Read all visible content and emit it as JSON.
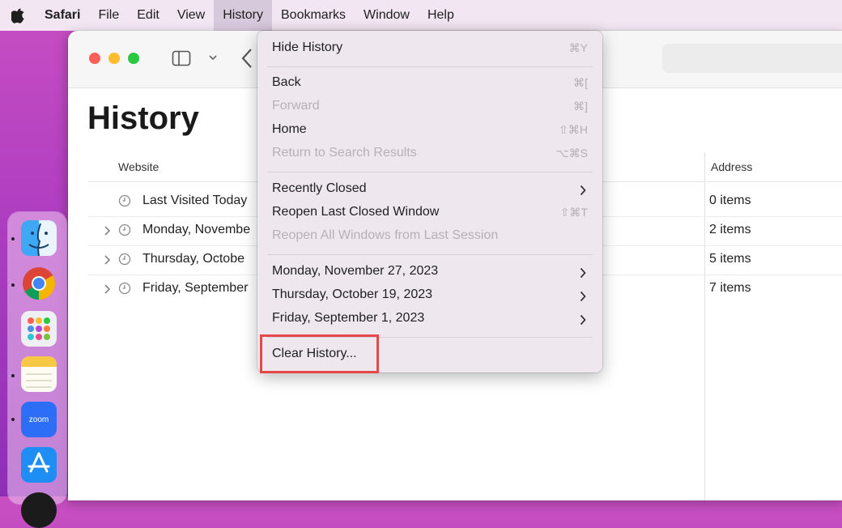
{
  "menubar": {
    "app_name": "Safari",
    "items": [
      "File",
      "Edit",
      "View",
      "History",
      "Bookmarks",
      "Window",
      "Help"
    ],
    "active_item": "History"
  },
  "page": {
    "title": "History",
    "columns": {
      "website": "Website",
      "address": "Address"
    },
    "rows": [
      {
        "label": "Last Visited Today",
        "count": "0 items",
        "expandable": false
      },
      {
        "label": "Monday, Novembe",
        "count": "2 items",
        "expandable": true
      },
      {
        "label": "Thursday, Octobe",
        "count": "5 items",
        "expandable": true
      },
      {
        "label": "Friday, September",
        "count": "7 items",
        "expandable": true
      }
    ]
  },
  "history_menu": {
    "hide_history": {
      "label": "Hide History",
      "shortcut": "⌘Y"
    },
    "back": {
      "label": "Back",
      "shortcut": "⌘["
    },
    "forward": {
      "label": "Forward",
      "shortcut": "⌘]"
    },
    "home": {
      "label": "Home",
      "shortcut": "⇧⌘H"
    },
    "return_to_search": {
      "label": "Return to Search Results",
      "shortcut": "⌥⌘S"
    },
    "recently_closed": {
      "label": "Recently Closed"
    },
    "reopen_last_window": {
      "label": "Reopen Last Closed Window",
      "shortcut": "⇧⌘T"
    },
    "reopen_all_windows": {
      "label": "Reopen All Windows from Last Session"
    },
    "days": [
      "Monday, November 27, 2023",
      "Thursday, October 19, 2023",
      "Friday, September 1, 2023"
    ],
    "clear_history": {
      "label": "Clear History..."
    }
  },
  "dock": {
    "apps": [
      "finder-icon",
      "chrome-icon",
      "launchpad-icon",
      "notes-icon",
      "zoom-icon",
      "app-store-icon"
    ],
    "zoom_label": "zoom"
  },
  "colors": {
    "highlight": "#e54848",
    "menubar_bg": "#f1e6f2",
    "menu_bg": "#eee7ee"
  }
}
